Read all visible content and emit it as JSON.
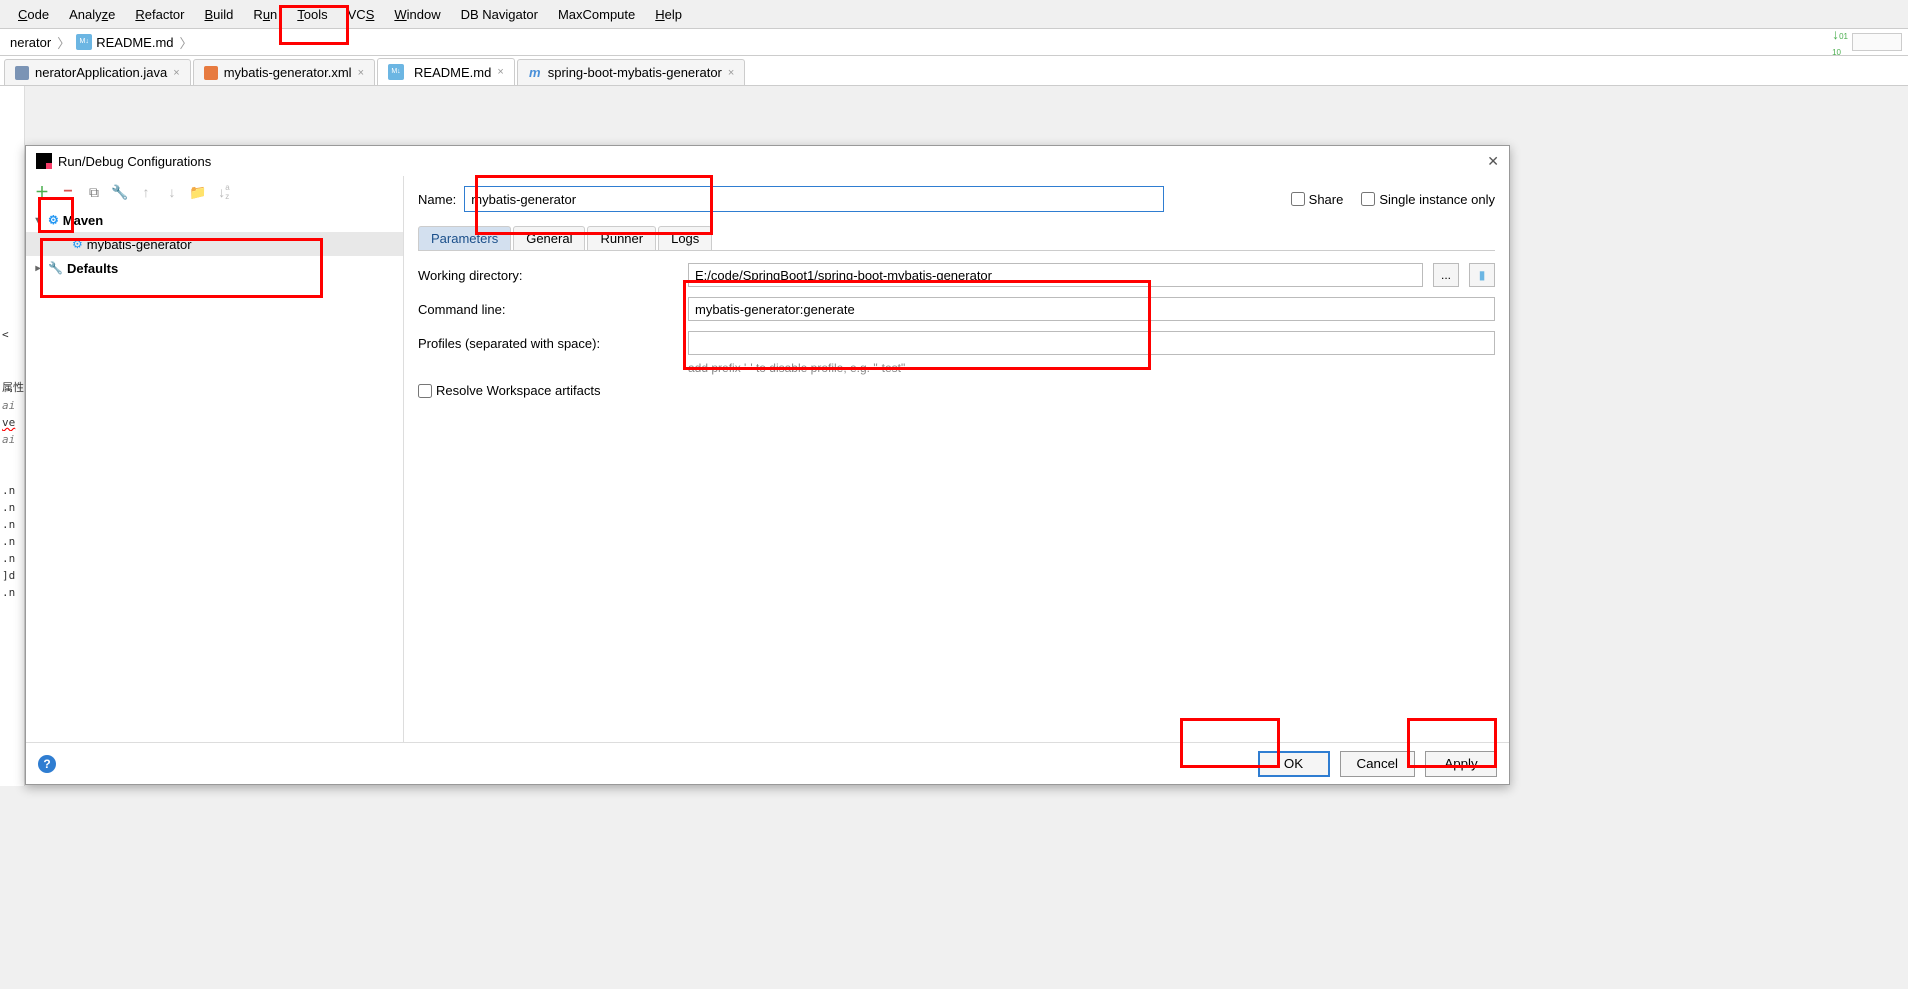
{
  "menu": [
    "Code",
    "Analyze",
    "Refactor",
    "Build",
    "Run",
    "Tools",
    "VCS",
    "Window",
    "DB Navigator",
    "MaxCompute",
    "Help"
  ],
  "menu_underline_idx": [
    0,
    4,
    0,
    0,
    0,
    0,
    2,
    0,
    -1,
    -1,
    0
  ],
  "breadcrumb": {
    "root": "nerator",
    "file": "README.md"
  },
  "editor_tabs": [
    {
      "label": "neratorApplication.java",
      "icon": "java"
    },
    {
      "label": "mybatis-generator.xml",
      "icon": "xml"
    },
    {
      "label": "README.md",
      "icon": "md",
      "active": true
    },
    {
      "label": "spring-boot-mybatis-generator",
      "icon": "m"
    }
  ],
  "left_snips": [
    "<",
    "",
    "",
    "属性",
    "ai",
    "ve",
    "ai",
    "",
    "",
    ".n",
    ".n",
    ".n",
    ".n",
    ".n",
    "]d",
    ".n"
  ],
  "dialog": {
    "title": "Run/Debug Configurations",
    "name_label": "Name:",
    "name_value": "mybatis-generator",
    "share_label": "Share",
    "single_label": "Single instance only",
    "tree": {
      "maven": "Maven",
      "config": "mybatis-generator",
      "defaults": "Defaults"
    },
    "tabs": [
      "Parameters",
      "General",
      "Runner",
      "Logs"
    ],
    "form": {
      "wd_label": "Working directory:",
      "wd_value": "E:/code/SpringBoot1/spring-boot-mybatis-generator",
      "cl_label": "Command line:",
      "cl_value": "mybatis-generator:generate",
      "pf_label": "Profiles (separated with space):",
      "pf_value": "",
      "hint": "add prefix '-' to disable profile, e.g. \"-test\"",
      "resolve_label": "Resolve Workspace artifacts"
    },
    "buttons": {
      "ok": "OK",
      "cancel": "Cancel",
      "apply": "Apply"
    }
  }
}
